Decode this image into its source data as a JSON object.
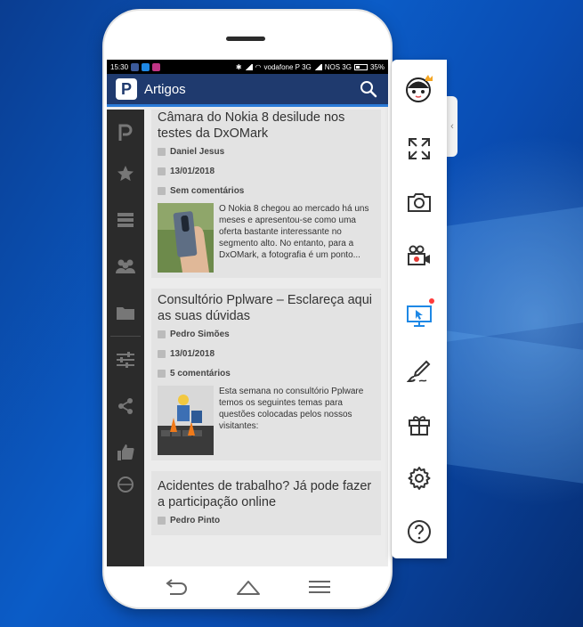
{
  "status_bar": {
    "time": "15:30",
    "carrier": "vodafone P 3G",
    "network2": "NOS 3G",
    "battery": "35%"
  },
  "app": {
    "title": "Artigos",
    "logo_letter": "P"
  },
  "articles": [
    {
      "title": "Câmara do Nokia 8 desilude nos testes da DxOMark",
      "author": "Daniel Jesus",
      "date": "13/01/2018",
      "comments": "Sem comentários",
      "excerpt": "O Nokia 8 chegou ao mercado há uns meses e apresentou-se como uma oferta bastante interessante no segmento alto. No entanto, para a DxOMark, a fotografia é um ponto..."
    },
    {
      "title": "Consultório Pplware – Esclareça aqui as suas dúvidas",
      "author": "Pedro Simões",
      "date": "13/01/2018",
      "comments": "5 comentários",
      "excerpt": "Esta semana no consultório Pplware temos os seguintes temas para questões colocadas pelos nossos visitantes:"
    },
    {
      "title": "Acidentes de trabalho? Já pode fazer a participação online",
      "author": "Pedro Pinto"
    }
  ],
  "left_nav": [
    "pplware-logo-icon",
    "star-icon",
    "list-icon",
    "people-icon",
    "folder-icon",
    "sliders-icon",
    "share-icon",
    "thumbs-up-icon",
    "globe-icon"
  ],
  "toolbar": {
    "tools": [
      "fullscreen-icon",
      "screenshot-icon",
      "record-icon",
      "screencast-icon",
      "brush-icon",
      "gift-icon",
      "settings-icon",
      "help-icon"
    ]
  },
  "colors": {
    "appbar": "#1f3a6e",
    "accent": "#2b7bd8",
    "badge": "#ff3b3b"
  }
}
